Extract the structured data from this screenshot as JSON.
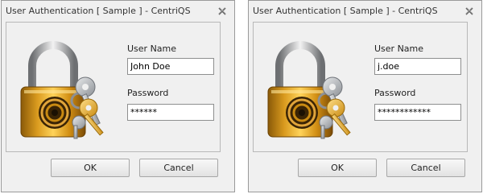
{
  "dialogs": [
    {
      "title": "User Authentication [ Sample ] - CentriQS",
      "username_label": "User Name",
      "username_value": "John Doe",
      "password_label": "Password",
      "password_value": "******",
      "ok_label": "OK",
      "cancel_label": "Cancel"
    },
    {
      "title": "User Authentication [ Sample ] - CentriQS",
      "username_label": "User Name",
      "username_value": "j.doe",
      "password_label": "Password",
      "password_value": "************",
      "ok_label": "OK",
      "cancel_label": "Cancel"
    }
  ],
  "icons": {
    "close": "close-icon",
    "lock": "padlock-with-keys-icon"
  },
  "colors": {
    "window_bg": "#f0f0f0",
    "lock_gold": "#e3a21a",
    "keys_silver": "#b9bdc2"
  }
}
